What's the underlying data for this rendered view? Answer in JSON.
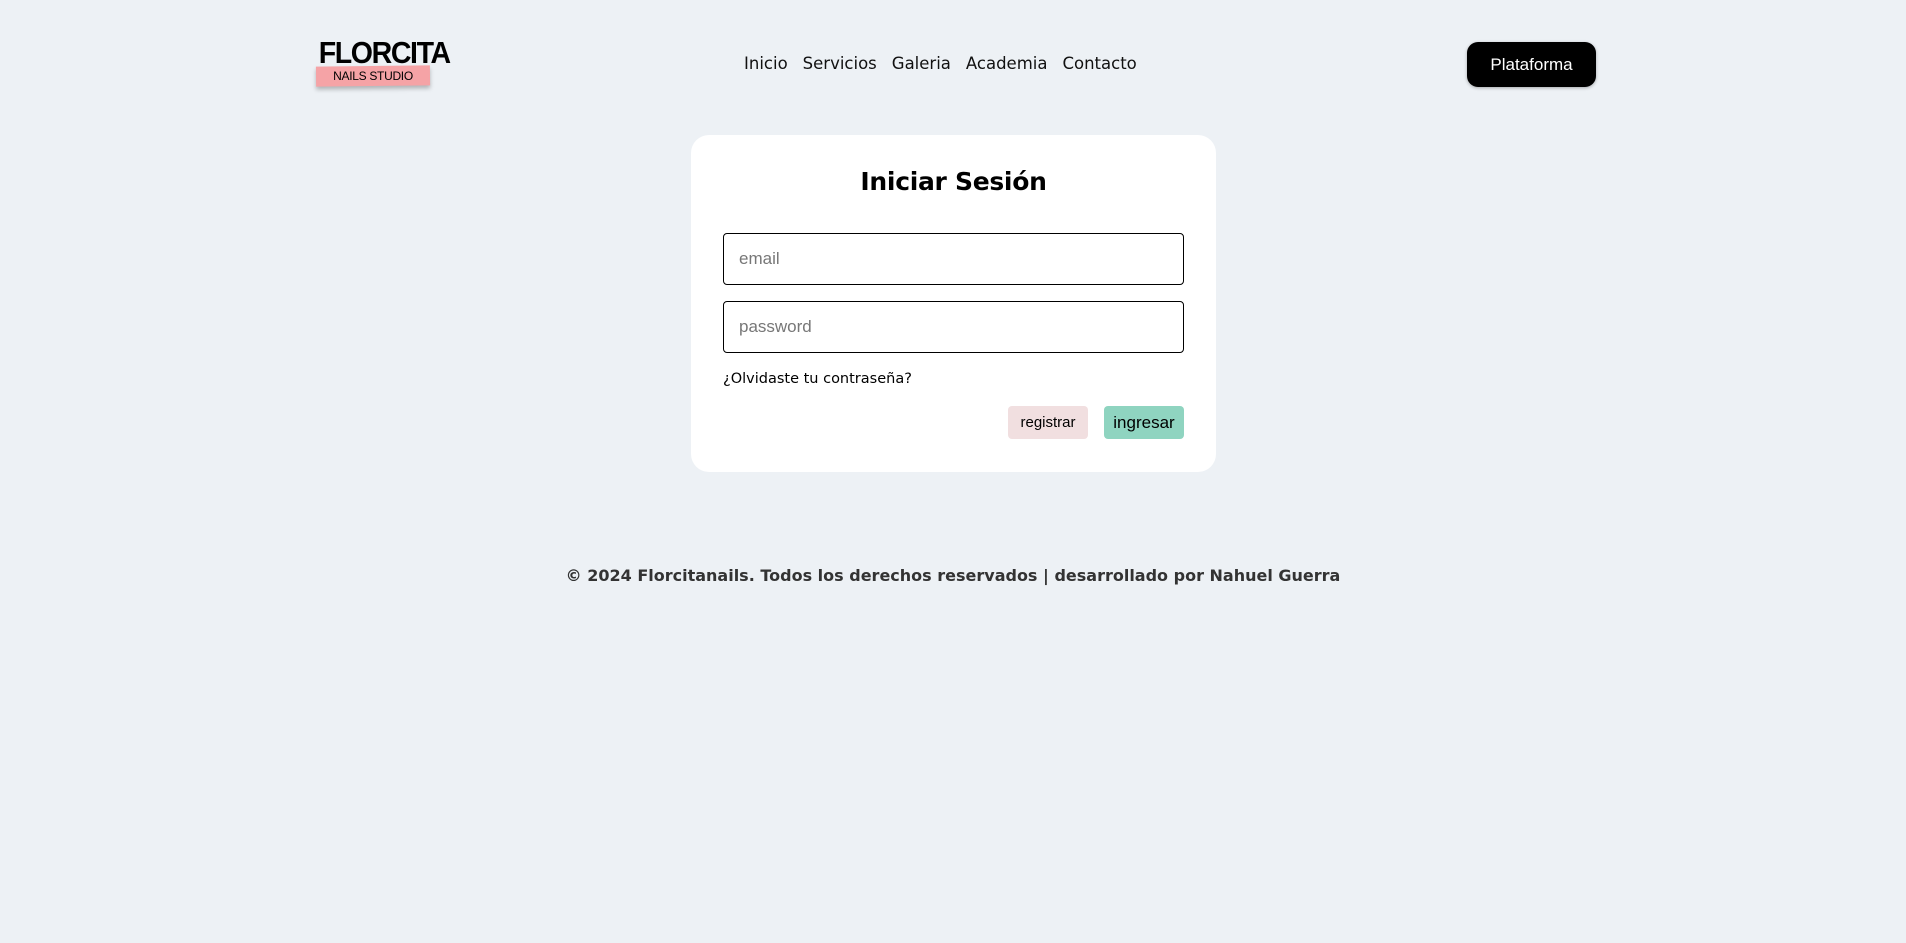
{
  "header": {
    "logo": {
      "title": "FLORCITA",
      "subtitle": "NAILS STUDIO"
    },
    "nav": [
      {
        "label": "Inicio"
      },
      {
        "label": "Servicios"
      },
      {
        "label": "Galeria"
      },
      {
        "label": "Academia"
      },
      {
        "label": "Contacto"
      }
    ],
    "platform_button": "Plataforma"
  },
  "login": {
    "title": "Iniciar Sesión",
    "email": {
      "placeholder": "email",
      "value": ""
    },
    "password": {
      "placeholder": "password",
      "value": ""
    },
    "forgot_link": "¿Olvidaste tu contraseña?",
    "register_button": "registrar",
    "submit_button": "ingresar"
  },
  "footer": {
    "text": "© 2024 Florcitanails. Todos los derechos reservados | desarrollado por Nahuel Guerra"
  },
  "colors": {
    "page_background": "#edf1f5",
    "card_background": "#ffffff",
    "logo_strip": "#f5a3a6",
    "register_button": "#f1dfe0",
    "submit_button": "#8fd4c0",
    "platform_button": "#000000"
  }
}
